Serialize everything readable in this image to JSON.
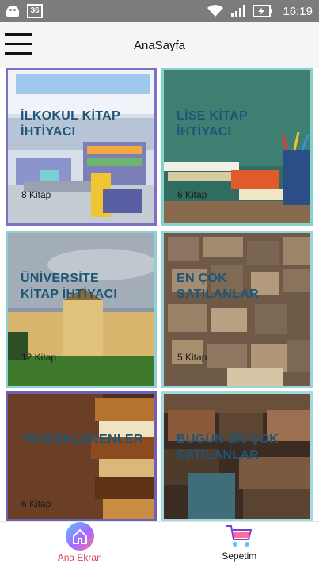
{
  "status_bar": {
    "time": "16:19",
    "badge_text": "36",
    "icons": [
      "android-icon",
      "badge-icon",
      "wifi-icon",
      "signal-icon",
      "battery-charging-icon"
    ]
  },
  "header": {
    "title": "AnaSayfa",
    "menu_icon": "hamburger-menu-icon"
  },
  "categories": [
    {
      "title": "İLKOKUL KİTAP\nİHTİYACI",
      "count": "8 Kitap",
      "image": "library-classroom"
    },
    {
      "title": "LİSE KİTAP\nİHTİYACI",
      "count": "6 Kitap",
      "image": "books-chalkboard-pencils"
    },
    {
      "title": "ÜNİVERSİTE\nKİTAP İHTİYACI",
      "count": "12 Kitap",
      "image": "university-palace"
    },
    {
      "title": "EN ÇOK\nSATILANLAR",
      "count": "5 Kitap",
      "image": "book-wall"
    },
    {
      "title": "YENİ EKLENENLER",
      "count": "6 Kitap",
      "image": "stacked-old-books"
    },
    {
      "title": "BUGÜN EN ÇOK\nSATILANLAR",
      "count": "",
      "image": "old-books-shelf"
    }
  ],
  "bottom_nav": {
    "items": [
      {
        "label": "Ana Ekran",
        "icon": "home-icon",
        "active": true
      },
      {
        "label": "Sepetim",
        "icon": "shopping-cart-icon",
        "active": false
      }
    ]
  },
  "colors": {
    "title_text": "#1f5576",
    "active_nav": "#e0455a",
    "status_bar": "#7c7c7c"
  }
}
